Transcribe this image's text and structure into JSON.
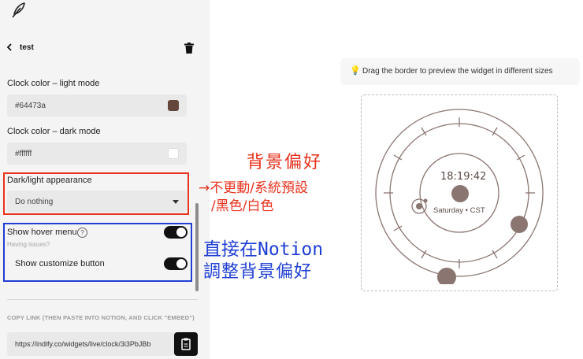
{
  "header": {
    "back_label": "test"
  },
  "settings": {
    "clock_light": {
      "label": "Clock color – light mode",
      "value": "#64473a",
      "color": "#64473a"
    },
    "clock_dark": {
      "label": "Clock color – dark mode",
      "value": "#ffffff",
      "color": "#ffffff"
    },
    "appearance": {
      "label": "Dark/light appearance",
      "selected": "Do nothing"
    },
    "hover_menu": {
      "label": "Show hover menu",
      "help_link": "Having issues?",
      "enabled": true
    },
    "customize": {
      "label": "Show customize button",
      "enabled": true
    },
    "copy_link": {
      "label": "COPY LINK (THEN PASTE INTO NOTION, AND CLICK \"EMBED\")",
      "url": "https://indify.co/widgets/live/clock/3i3PbJBb"
    }
  },
  "preview": {
    "hint": "Drag the border to preview the widget in different sizes",
    "time": "18:19:42",
    "date": "Saturday • CST"
  },
  "annotations": {
    "red_title": "背景偏好",
    "red_line1": "→不更動/系統預設",
    "red_line2": "/黑色/白色",
    "blue_line1": "直接在Notion",
    "blue_line2": "調整背景偏好"
  },
  "colors": {
    "accent_red": "#e8321e",
    "accent_blue": "#1f3fd4",
    "clock_brown": "#8a7570"
  }
}
